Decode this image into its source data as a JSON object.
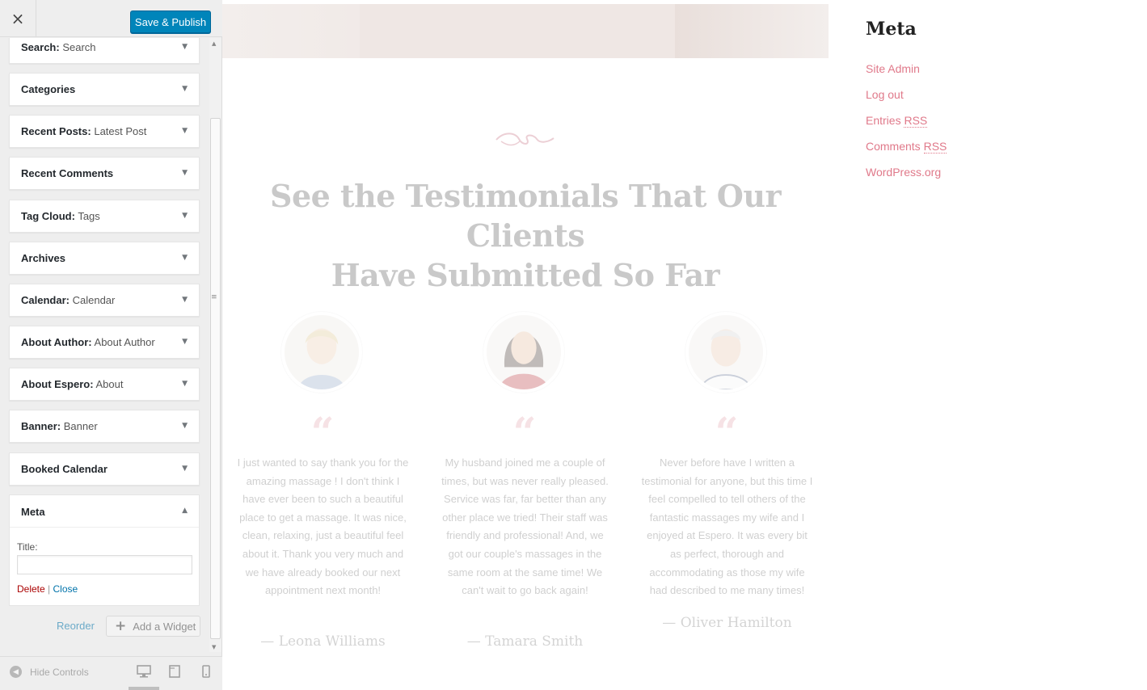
{
  "topbar": {
    "close_icon": "×",
    "save_label": "Save & Publish"
  },
  "widgets": [
    {
      "title": "Search",
      "sub": "Search"
    },
    {
      "title": "Categories",
      "sub": ""
    },
    {
      "title": "Recent Posts",
      "sub": "Latest Post"
    },
    {
      "title": "Recent Comments",
      "sub": ""
    },
    {
      "title": "Tag Cloud",
      "sub": "Tags"
    },
    {
      "title": "Archives",
      "sub": ""
    },
    {
      "title": "Calendar",
      "sub": "Calendar"
    },
    {
      "title": "About Author",
      "sub": "About Author"
    },
    {
      "title": "About Espero",
      "sub": "About"
    },
    {
      "title": "Banner",
      "sub": "Banner"
    },
    {
      "title": "Booked Calendar",
      "sub": ""
    }
  ],
  "meta_widget": {
    "title": "Meta",
    "title_label": "Title:",
    "title_value": "",
    "delete_label": "Delete",
    "separator": "|",
    "close_label": "Close"
  },
  "widget_actions": {
    "reorder_label": "Reorder",
    "add_widget_label": "Add a Widget"
  },
  "footer": {
    "hide_controls_label": "Hide Controls",
    "devices": [
      "desktop-icon",
      "tablet-icon",
      "mobile-icon"
    ]
  },
  "preview": {
    "heading_line1": "See the Testimonials That Our Clients",
    "heading_line2": "Have Submitted So Far",
    "testimonials": [
      {
        "quote": "“",
        "text": "I just wanted to say thank you for the amazing massage ! I don't think I have ever been to such a beautiful place to get a massage. It was nice, clean, relaxing, just a beautiful feel about it. Thank you very much and we have already booked our next appointment next month!",
        "author": "— Leona Williams"
      },
      {
        "quote": "“",
        "text": "My husband joined me a couple of times, but was never really pleased. Service was far, far better than any other place we tried! Their staff was friendly and professional! And, we got our couple's massages in the same room at the same time! We can't wait to go back again!",
        "author": "— Tamara Smith"
      },
      {
        "quote": "“",
        "text": "Never before have I written a testimonial for anyone, but this time I feel compelled to tell others of the fantastic massages my wife and I enjoyed at Espero. It was every bit as perfect, thorough and accommodating as those my wife had described to me many times!",
        "author": "— Oliver Hamilton"
      }
    ]
  },
  "meta_sidebar": {
    "heading": "Meta",
    "links": [
      "Site Admin",
      "Log out",
      "Entries ",
      "Comments ",
      "WordPress.org"
    ],
    "rss_abbr": "RSS"
  },
  "colors": {
    "accent": "#0085ba",
    "link_pink": "#e0798a",
    "quote_pink": "#e3a4ad"
  }
}
